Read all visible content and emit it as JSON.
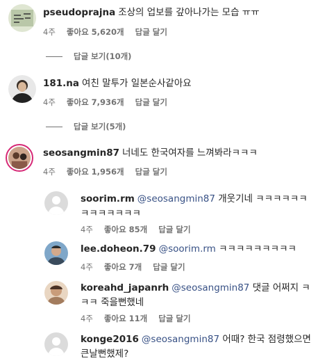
{
  "comments": [
    {
      "username": "pseudoprajna",
      "text": "조상의 업보를 갚아나가는 모습 ㅠㅠ",
      "time": "4주",
      "likes": "좋아요 5,620개",
      "reply": "답글 달기",
      "view_replies": "답글 보기(10개)"
    },
    {
      "username": "181.na",
      "text": "여친 말투가 일본순사같아요",
      "time": "4주",
      "likes": "좋아요 7,936개",
      "reply": "답글 달기",
      "view_replies": "답글 보기(5개)"
    },
    {
      "username": "seosangmin87",
      "text": "너네도 한국여자를 느껴봐라ㅋㅋㅋ",
      "time": "4주",
      "likes": "좋아요 1,956개",
      "reply": "답글 달기"
    }
  ],
  "replies": [
    {
      "username": "soorim.rm",
      "mention": "@seosangmin87",
      "text": "개웃기네 ㅋㅋㅋㅋㅋㅋㅋㅋㅋㅋㅋㅋㅋ",
      "time": "4주",
      "likes": "좋아요 85개",
      "reply": "답글 달기"
    },
    {
      "username": "lee.doheon.79",
      "mention": "@soorim.rm",
      "text": "ㅋㅋㅋㅋㅋㅋㅋㅋㅋ",
      "time": "4주",
      "likes": "좋아요 7개",
      "reply": "답글 달기"
    },
    {
      "username": "koreahd_japanrh",
      "mention": "@seosangmin87",
      "text": "댓글 어쩌지 ㅋㅋㅋ 죽을뻔했네",
      "time": "4주",
      "likes": "좋아요 11개",
      "reply": "답글 달기"
    },
    {
      "username": "konge2016",
      "mention": "@seosangmin87",
      "text": "어때? 한국 점령했으면 큰날뻔했제?"
    }
  ]
}
